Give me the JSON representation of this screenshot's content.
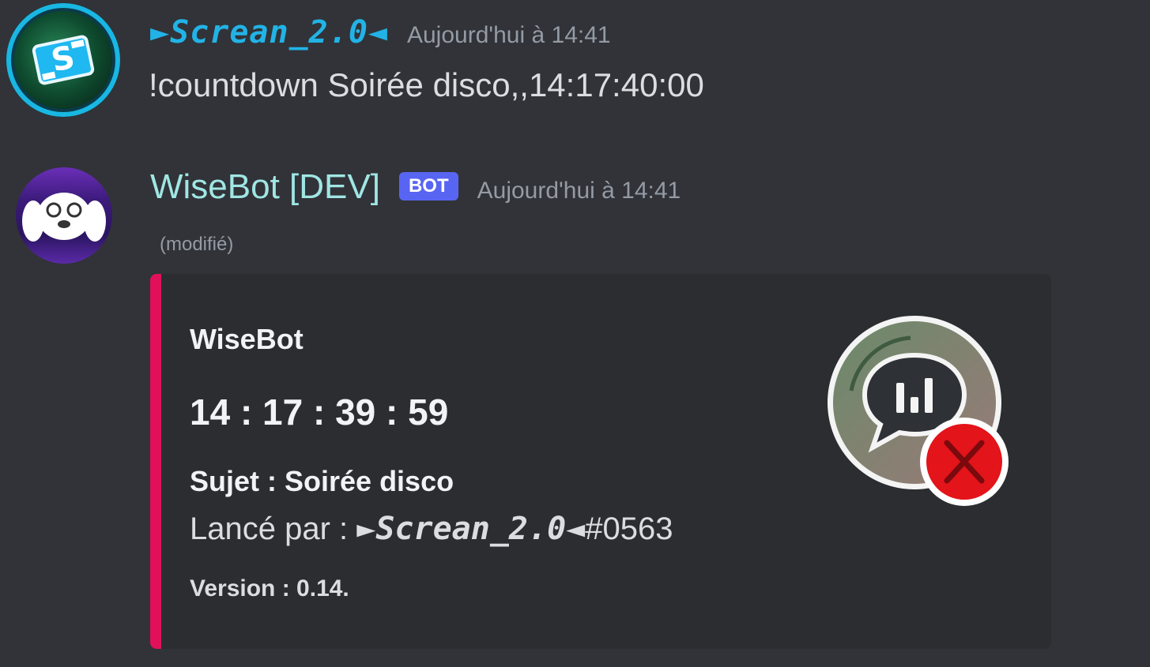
{
  "message1": {
    "username": "►Screan_2.0◄",
    "timestamp": "Aujourd'hui à 14:41",
    "content": "!countdown Soirée disco,,14:17:40:00"
  },
  "message2": {
    "username": "WiseBot [DEV]",
    "badge": "BOT",
    "timestamp": "Aujourd'hui à 14:41",
    "edited": "(modifié)",
    "embed": {
      "author": "WiseBot",
      "title": "14 : 17 : 39 : 59",
      "subject": "Sujet : Soirée disco",
      "launched_prefix": "Lancé par : ",
      "launched_user": "►Screan_2.0◄",
      "launched_tag": "#0563",
      "footer": "Version : 0.14.",
      "accent_color": "#e0115a",
      "thumbnail_icon": "poll-chat-icon"
    }
  },
  "colors": {
    "background": "#313338",
    "username1": "#22b3e6",
    "username2": "#a0e6e4",
    "bot_badge": "#5865f2"
  }
}
